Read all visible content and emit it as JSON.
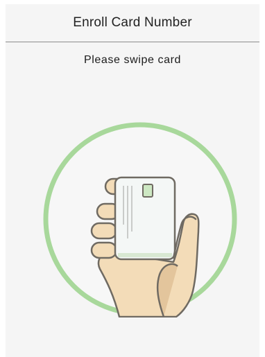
{
  "header": {
    "title": "Enroll Card Number"
  },
  "prompt": {
    "text": "Please swipe card"
  },
  "illustration": {
    "icon": "hand-holding-card-icon",
    "ring_color": "#9dd38f",
    "skin_color": "#f3dcb8",
    "card_color": "#f4f7f6"
  }
}
